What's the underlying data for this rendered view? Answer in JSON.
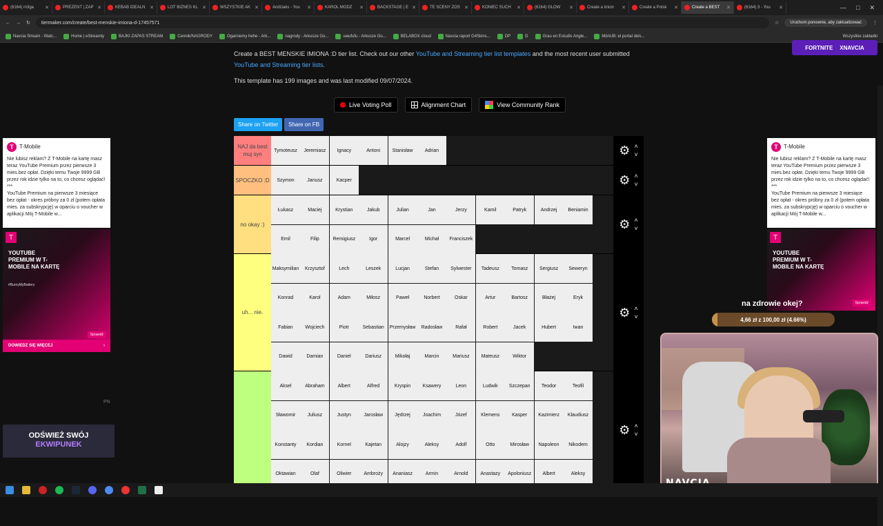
{
  "tabs": [
    {
      "label": "(6164) m3ga",
      "active": false
    },
    {
      "label": "PREZENT | ZAP",
      "active": false
    },
    {
      "label": "KEBAB IDEALN",
      "active": false
    },
    {
      "label": "LOT BIZNES KL",
      "active": false
    },
    {
      "label": "WSZYSTKIE AK",
      "active": false
    },
    {
      "label": "Andziaks - You",
      "active": false
    },
    {
      "label": "KAROL MODZ",
      "active": false
    },
    {
      "label": "BACKSTAGE | E",
      "active": false
    },
    {
      "label": "TE SCENY ZOS",
      "active": false
    },
    {
      "label": "KONIEC SUCH",
      "active": false
    },
    {
      "label": "(6164) GLOW",
      "active": false
    },
    {
      "label": "Create a imion",
      "active": false
    },
    {
      "label": "Create a Polsk",
      "active": false
    },
    {
      "label": "Create a BEST",
      "active": true
    },
    {
      "label": "(6164) 3 - You",
      "active": false
    }
  ],
  "browser": {
    "url": "tiermaker.com/create/best-menskie-imiona-d-17457571",
    "update_label": "Uruchom ponownie, aby zaktualizować",
    "bookmarks_all": "Wszystkie zakładki"
  },
  "bookmarks": [
    "Navcia Stream - Watc...",
    "Home | eStreamly",
    "BAJKI ZAPAS STREAM",
    "Cennik/NAGRODY",
    "Ogarniemy hehe - Ark...",
    "nagrody - Arkusze Go...",
    "uwufufu - Arkusze Go...",
    "BELABOX cloud",
    "Navcia raport G4Skins...",
    "DP",
    "D",
    "Grau en Estudis Angle...",
    "MónUB: el portal dels..."
  ],
  "intro": {
    "text1": "Create a BEST MENSKIE IMIONA :D tier list. Check out our other ",
    "link1": "YouTube and Streaming tier list templates",
    "text2": " and the most recent user submitted ",
    "link2": "YouTube and Streaming tier lists",
    "text3": "."
  },
  "stat": "This template has 199 images and was last modified 09/07/2024.",
  "buttons": {
    "poll": "Live Voting Poll",
    "alignment": "Alignment Chart",
    "community": "View Community Rank",
    "twitter": "Share on Twitter",
    "fb": "Share on FB"
  },
  "colors": {
    "tier1": "#ff7f7f",
    "tier2": "#ffbf7f",
    "tier3": "#ffdf7f",
    "tier4": "#ffff7f",
    "tier5": "#bfff7f",
    "accent": "#e20074"
  },
  "tiers": [
    {
      "label": "NAJ da best muj syn",
      "color": "#ff7f7f",
      "items": [
        "Tymoteusz",
        "Jeremiasz",
        "Ignacy",
        "Antoni",
        "Stanisław",
        "Adrian"
      ]
    },
    {
      "label": "SPOCZKO :D",
      "color": "#ffbf7f",
      "items": [
        "Szymon",
        "Janusz",
        "Kacper"
      ]
    },
    {
      "label": "no okay :)",
      "color": "#ffdf7f",
      "items": [
        "Łukasz",
        "Maciej",
        "Krystian",
        "Jakub",
        "Julian",
        "Jan",
        "Jerzy",
        "Kamil",
        "Patryk",
        "Andrzej",
        "Beniamin",
        "Emil",
        "Filip",
        "Remigiusz",
        "Igor",
        "Marcel",
        "Michał",
        "Franciszek"
      ]
    },
    {
      "label": "uh... nie.",
      "color": "#ffff7f",
      "items": [
        "Maksymilian",
        "Krzysztof",
        "Lech",
        "Leszek",
        "Lucjan",
        "Stefan",
        "Sylwester",
        "Tadeusz",
        "Tomasz",
        "Sergiusz",
        "Seweryn",
        "Konrad",
        "Karol",
        "Adam",
        "Miłosz",
        "Paweł",
        "Norbert",
        "Oskar",
        "Artur",
        "Bartosz",
        "Błażej",
        "Eryk",
        "Fabian",
        "Wojciech",
        "Piotr",
        "Sebastian",
        "Przemysław",
        "Radosław",
        "Rafał",
        "Robert",
        "Jacek",
        "Hubert",
        "Iwan",
        "Dawid",
        "Damian",
        "Daniel",
        "Dariusz",
        "Mikołaj",
        "Marcin",
        "Mariusz",
        "Mateusz",
        "Wiktor"
      ]
    },
    {
      "label": "",
      "color": "#bfff7f",
      "items": [
        "Aksel",
        "Abraham",
        "Albert",
        "Alfred",
        "Kryspin",
        "Ksawery",
        "Leon",
        "Ludwik",
        "Szczepan",
        "Teodor",
        "Teofil",
        "Sławomir",
        "Juliusz",
        "Justyn",
        "Jarosław",
        "Jędrzej",
        "Joachim",
        "Józef",
        "Klemens",
        "Kasper",
        "Kazimierz",
        "Klaudiusz",
        "Konstanty",
        "Kordian",
        "Kornel",
        "Kajetan",
        "Alojzy",
        "Aleksy",
        "Adolf",
        "Otto",
        "Mirosław",
        "Napoleon",
        "Nikodem",
        "Oktawian",
        "Olaf",
        "Oliwier",
        "Ambroży",
        "Ananiasz",
        "Armin",
        "Arnold",
        "Anastazy",
        "Apoloniusz",
        "Albert",
        "Aleksy"
      ]
    }
  ],
  "ads": {
    "left": {
      "brand": "T-Mobile",
      "text1": "Nie lubisz reklam? Z T-Mobile na kartę masz teraz YouTube Premium przez pierwsze 3 mies.bez opłat. Dzięki temu Twoje 9999 GB przez rok idzie tylko na to, co chcesz oglądać!",
      "stars": "***",
      "text2": "YouTube Premium na pierwsze 3 miesiące bez opłat - okres próbny za 0 zł (potem opłata mies. za subskrypcję) w oparciu o voucher w aplikacji Mój T-Mobile w...",
      "headline": "YOUTUBE PREMIUM W T-MOBILE NA KARTĘ",
      "hashtag": "#BurnyMyBattery",
      "mini_btn": "Sprawdź",
      "cta": "DOWIEDZ SIĘ WIĘCEJ"
    },
    "right": {
      "brand": "T-Mobile",
      "text1": "Nie lubisz reklam? Z T-Mobile na kartę masz teraz YouTube Premium przez pierwsze 3 mies.bez opłat. Dzięki temu Twoje 9999 GB przez rok idzie tylko na to, co chcesz oglądać!",
      "stars": "***",
      "text2": "YouTube Premium na pierwsze 3 miesiące bez opłat - okres próbny za 0 zł (potem opłata mies. za subskrypcję) w oparciu o voucher w aplikacji Mój T-Mobile w...",
      "headline": "YOUTUBE PREMIUM W T-MOBILE NA KARTĘ",
      "mini_btn": "Sprawdź"
    }
  },
  "overlay": {
    "fortnite": "FORTNITE",
    "creator": "XNAVCIA",
    "goal_question": "na zdrowie okej?",
    "goal_text": "4,66 zł z 100,00 zł (4.66%)",
    "goal_progress": 0.0466,
    "cam_name": "NAVCIA",
    "promo_line1": "ODŚWIEŻ SWÓJ",
    "promo_line2": "EKWIPUNEK",
    "pn": "PN"
  }
}
